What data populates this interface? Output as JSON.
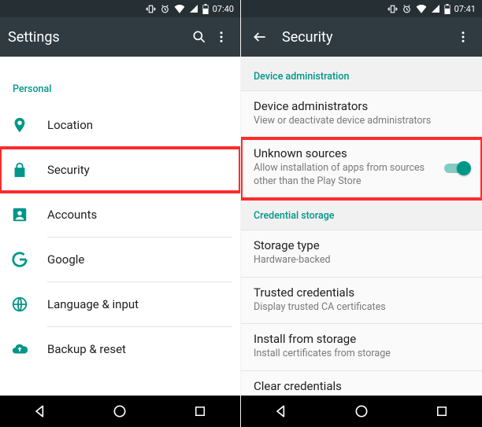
{
  "left": {
    "status_time": "07:40",
    "appbar_title": "Settings",
    "section_personal": "Personal",
    "items": [
      {
        "label": "Location"
      },
      {
        "label": "Security"
      },
      {
        "label": "Accounts"
      },
      {
        "label": "Google"
      },
      {
        "label": "Language & input"
      },
      {
        "label": "Backup & reset"
      }
    ]
  },
  "right": {
    "status_time": "07:41",
    "appbar_title": "Security",
    "section_admin": "Device administration",
    "section_cred": "Credential storage",
    "items": {
      "device_admin_t": "Device administrators",
      "device_admin_s": "View or deactivate device administrators",
      "unknown_t": "Unknown sources",
      "unknown_s": "Allow installation of apps from sources other than the Play Store",
      "storage_t": "Storage type",
      "storage_s": "Hardware-backed",
      "trusted_t": "Trusted credentials",
      "trusted_s": "Display trusted CA certificates",
      "install_t": "Install from storage",
      "install_s": "Install certificates from storage",
      "clear_t": "Clear credentials"
    }
  }
}
